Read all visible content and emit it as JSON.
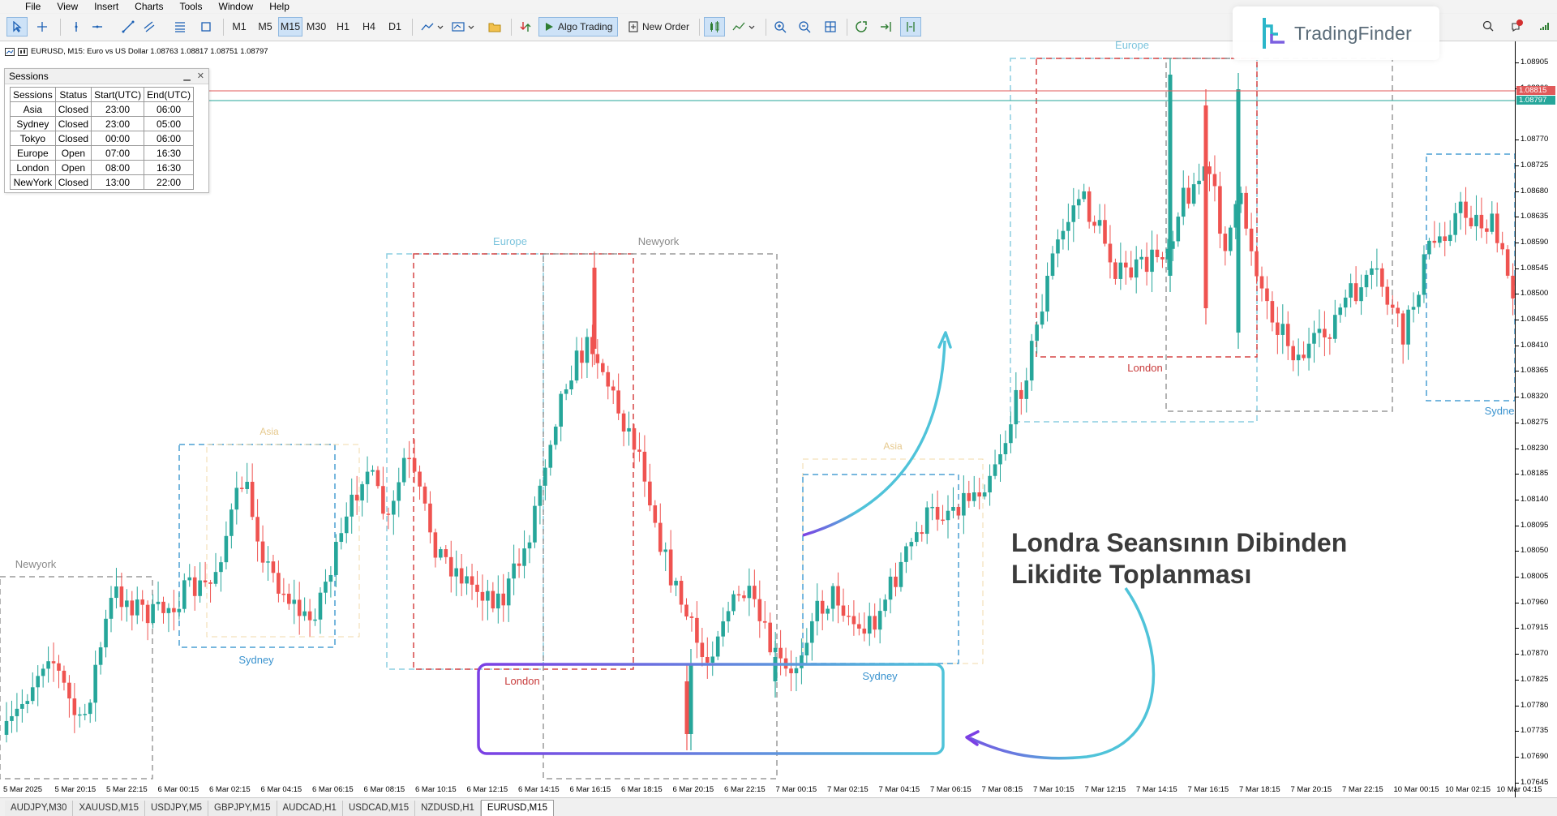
{
  "menu": [
    "File",
    "View",
    "Insert",
    "Charts",
    "Tools",
    "Window",
    "Help"
  ],
  "toolbar": {
    "timeframes": [
      "M1",
      "M5",
      "M15",
      "M30",
      "H1",
      "H4",
      "D1"
    ],
    "active_timeframe": "M15",
    "algo_trading": "Algo Trading",
    "new_order": "New Order"
  },
  "logo": {
    "text": "TradingFinder"
  },
  "chart": {
    "header": "EURUSD, M15:  Euro vs US Dollar  1.08763 1.08817 1.08751 1.08797",
    "price_labels": [
      "1.08905",
      "1.08860",
      "1.08770",
      "1.08725",
      "1.08680",
      "1.08635",
      "1.08590",
      "1.08545",
      "1.08500",
      "1.08455",
      "1.08410",
      "1.08365",
      "1.08320",
      "1.08275",
      "1.08230",
      "1.08185",
      "1.08140",
      "1.08095",
      "1.08050",
      "1.08005",
      "1.07960",
      "1.07915",
      "1.07870",
      "1.07825",
      "1.07780",
      "1.07735",
      "1.07690",
      "1.07645"
    ],
    "bid_label": "1.08815",
    "ask_label": "1.08797",
    "time_labels": [
      "5 Mar 2025",
      "5 Mar 20:15",
      "5 Mar 22:15",
      "6 Mar 00:15",
      "6 Mar 02:15",
      "6 Mar 04:15",
      "6 Mar 06:15",
      "6 Mar 08:15",
      "6 Mar 10:15",
      "6 Mar 12:15",
      "6 Mar 14:15",
      "6 Mar 16:15",
      "6 Mar 18:15",
      "6 Mar 20:15",
      "6 Mar 22:15",
      "7 Mar 00:15",
      "7 Mar 02:15",
      "7 Mar 04:15",
      "7 Mar 06:15",
      "7 Mar 08:15",
      "7 Mar 10:15",
      "7 Mar 12:15",
      "7 Mar 14:15",
      "7 Mar 16:15",
      "7 Mar 18:15",
      "7 Mar 20:15",
      "7 Mar 22:15",
      "10 Mar 00:15",
      "10 Mar 02:15",
      "10 Mar 04:15"
    ]
  },
  "session_labels": {
    "newyork": "Newyork",
    "asia": "Asia",
    "sydney": "Sydney",
    "europe": "Europe",
    "london": "London",
    "sydney_cut": "Sydne"
  },
  "sessions_panel": {
    "title": "Sessions",
    "headers": [
      "Sessions",
      "Status",
      "Start(UTC)",
      "End(UTC)"
    ],
    "rows": [
      [
        "Asia",
        "Closed",
        "23:00",
        "06:00"
      ],
      [
        "Sydney",
        "Closed",
        "23:00",
        "05:00"
      ],
      [
        "Tokyo",
        "Closed",
        "00:00",
        "06:00"
      ],
      [
        "Europe",
        "Open",
        "07:00",
        "16:30"
      ],
      [
        "London",
        "Open",
        "08:00",
        "16:30"
      ],
      [
        "NewYork",
        "Closed",
        "13:00",
        "22:00"
      ]
    ]
  },
  "annotation": {
    "line1": "Londra Seansının Dibinden",
    "line2": "Likidite Toplanması"
  },
  "tabs": [
    "AUDJPY,M30",
    "XAUUSD,M15",
    "USDJPY,M5",
    "GBPJPY,M15",
    "AUDCAD,H1",
    "USDCAD,M15",
    "NZDUSD,H1",
    "EURUSD,M15"
  ],
  "active_tab": "EURUSD,M15",
  "colors": {
    "bull": "#26a69a",
    "bear": "#ef5350",
    "sweep_box": "#7b3fe4",
    "arrow": "#4fc3d9"
  }
}
